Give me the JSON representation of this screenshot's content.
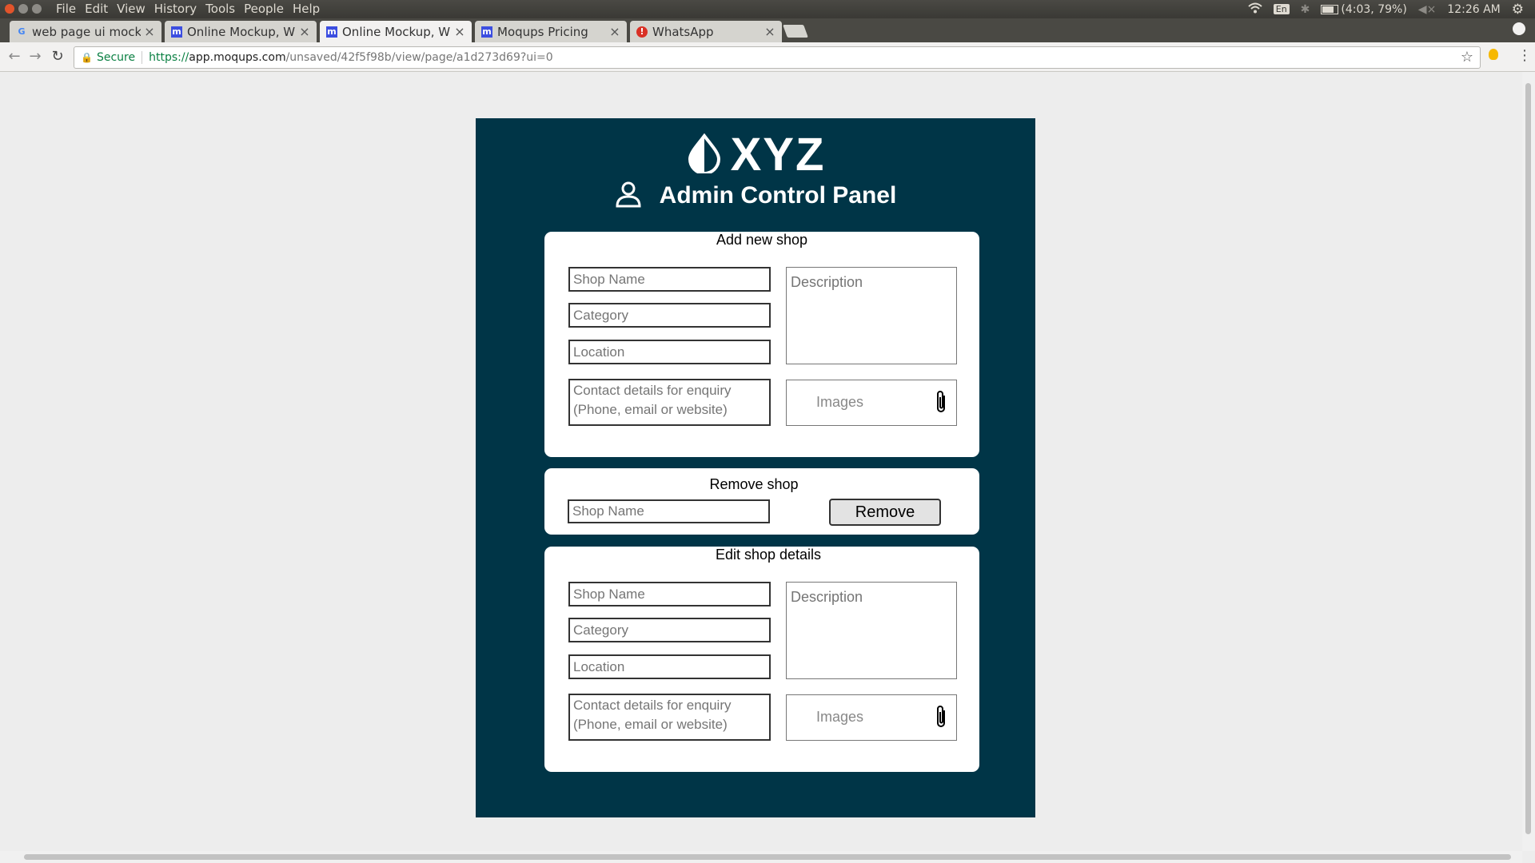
{
  "os": {
    "menu": [
      "File",
      "Edit",
      "View",
      "History",
      "Tools",
      "People",
      "Help"
    ],
    "keyboard_layout": "En",
    "battery": "(4:03, 79%)",
    "clock": "12:26 AM"
  },
  "browser": {
    "tabs": [
      {
        "title": "web page ui mocku",
        "icon": "google-icon"
      },
      {
        "title": "Online Mockup, Wi",
        "icon": "moqups-icon"
      },
      {
        "title": "Online Mockup, Wi",
        "icon": "moqups-icon",
        "active": true
      },
      {
        "title": "Moqups Pricing",
        "icon": "moqups-icon"
      },
      {
        "title": "WhatsApp",
        "icon": "error-icon"
      }
    ],
    "secure_label": "Secure",
    "url_scheme": "https://",
    "url_host": "app.moqups.com",
    "url_path": "/unsaved/42f5f98b/view/page/a1d273d69?ui=0"
  },
  "panel": {
    "brand": "XYZ",
    "title": "Admin Control Panel",
    "add_shop": {
      "heading": "Add new shop",
      "shop_name_placeholder": "Shop Name",
      "category_placeholder": "Category",
      "location_placeholder": "Location",
      "contact_placeholder": "Contact details for enquiry\n(Phone, email or website)",
      "description_placeholder": "Description",
      "images_label": "Images"
    },
    "remove_shop": {
      "heading": "Remove shop",
      "shop_name_placeholder": "Shop Name",
      "button_label": "Remove"
    },
    "edit_shop": {
      "heading": "Edit shop details",
      "shop_name_placeholder": "Shop Name",
      "category_placeholder": "Category",
      "location_placeholder": "Location",
      "contact_placeholder": "Contact details for enquiry\n(Phone, email or website)",
      "description_placeholder": "Description",
      "images_label": "Images"
    }
  }
}
